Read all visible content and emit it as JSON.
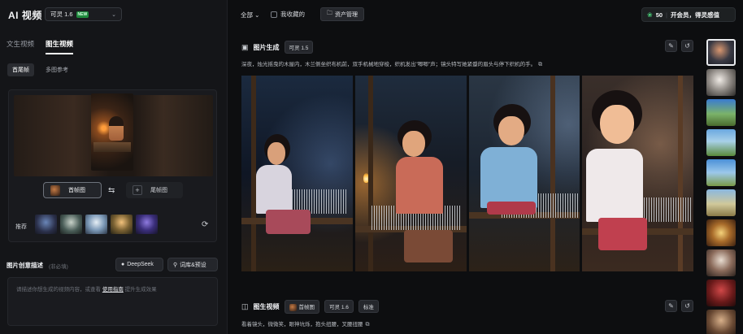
{
  "app": {
    "title": "AI 视频"
  },
  "model_select": {
    "label": "可灵 1.6",
    "badge": "NEW"
  },
  "tabs": [
    {
      "label": "文生视频",
      "active": false
    },
    {
      "label": "图生视频",
      "active": true
    }
  ],
  "subtabs": [
    {
      "label": "首尾帧",
      "active": true
    },
    {
      "label": "多图参考",
      "active": false
    }
  ],
  "frames": {
    "first_label": "首帧图",
    "last_label": "尾帧图",
    "recommend_label": "推荐"
  },
  "description": {
    "label": "图片创意描述",
    "hint": "(非必填)",
    "deepseek": "DeepSeek",
    "library": "词库&预设",
    "placeholder_a": "请描述你想生成的视频内容，或查看",
    "guide_link": "使用指南",
    "placeholder_b": "提升生成效果"
  },
  "topbar": {
    "filter": "全部",
    "favorites": "我收藏的",
    "asset_manage": "资产管理",
    "credits": "50",
    "vip": "开会员，得灵感值"
  },
  "image_section": {
    "title": "图片生成",
    "tag": "可灵 1.5",
    "prompt": "深夜，烛光摇曳的木屋内，木兰侧坐织布机前，双手机械地穿梭，织机发出\"唧唧\"声；镜头特写她紧蹙的眉头与停下织机的手。"
  },
  "video_section": {
    "title": "图生视频",
    "tags": [
      "首帧图",
      "可灵 1.6",
      "标准"
    ],
    "prompt": "看着镜头，微微笑，眼神坑烁，抱头扭腰，叉腰扭腰"
  },
  "icons": {
    "image_section": "image-icon",
    "video_section": "video-icon",
    "edit": "edit-icon",
    "undo": "undo-icon",
    "copy": "copy-icon",
    "swap": "swap-icon",
    "refresh": "refresh-icon",
    "folder": "folder-icon",
    "leaf": "leaf-icon",
    "deepseek": "deepseek-icon",
    "location": "location-pin-icon"
  },
  "colors": {
    "background": "#0d0e10",
    "panel": "#141518",
    "new_badge": "#1f8a3d",
    "credits_icon": "#4bd07a"
  }
}
